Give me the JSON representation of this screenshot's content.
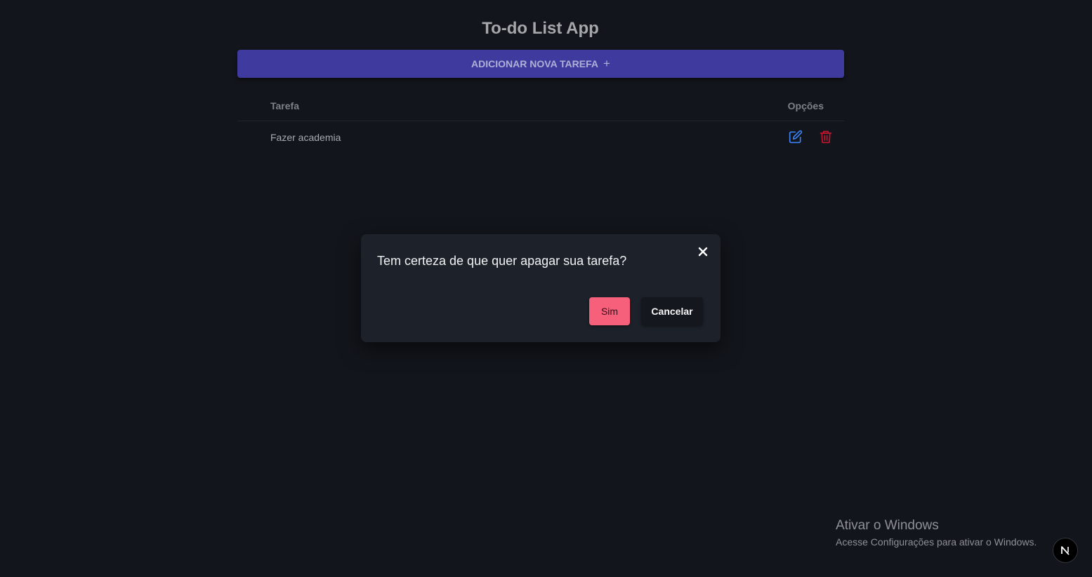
{
  "app": {
    "title": "To-do List App"
  },
  "toolbar": {
    "add_task_label": "ADICIONAR NOVA TAREFA",
    "add_task_icon": "+"
  },
  "table": {
    "columns": [
      "Tarefa",
      "Opções"
    ],
    "rows": [
      {
        "task": "Fazer academia"
      }
    ]
  },
  "modal": {
    "message": "Tem certeza de que quer apagar sua tarefa?",
    "close_icon": "close-icon",
    "confirm_label": "Sim",
    "cancel_label": "Cancelar"
  },
  "watermark": {
    "title": "Ativar o Windows",
    "subtitle": "Acesse Configurações para ativar o Windows."
  },
  "badge": {
    "letter": "N"
  },
  "colors": {
    "background": "#12151b",
    "primary_button": "#3f3a9e",
    "edit_icon": "#3b82f6",
    "delete_icon": "#c3162f",
    "confirm_button": "#f7607b",
    "modal_background": "#1d222a"
  }
}
